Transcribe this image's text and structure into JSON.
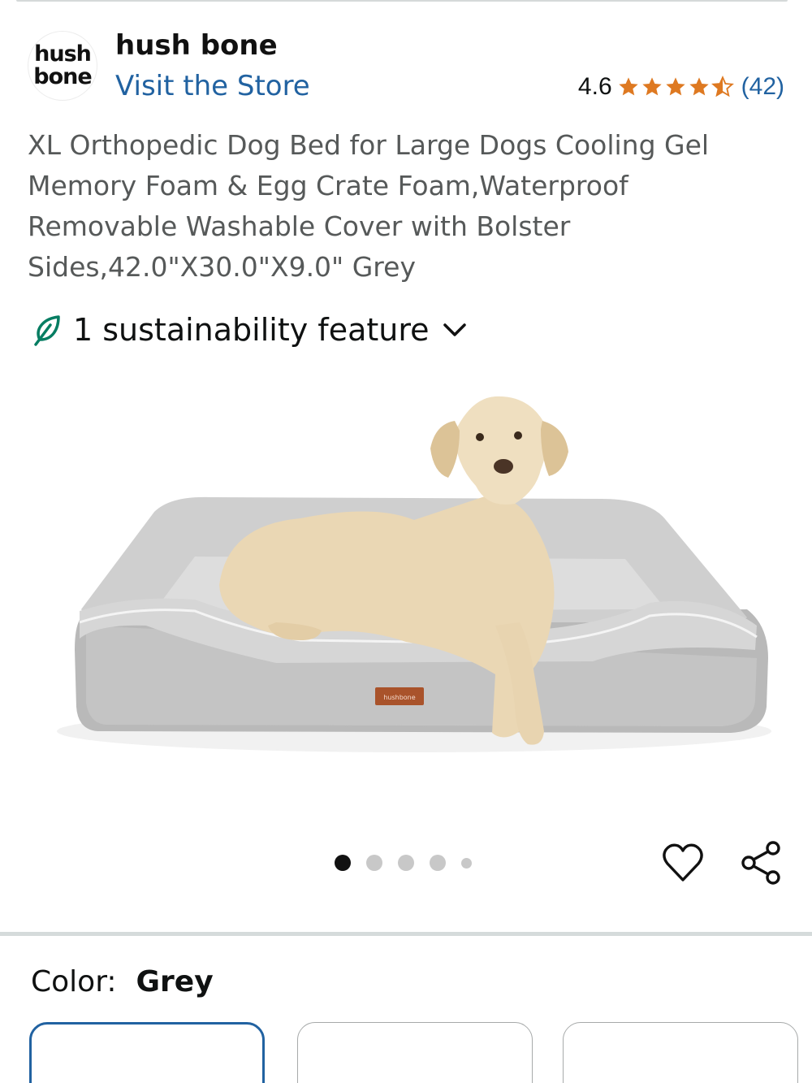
{
  "brand": {
    "logo_line1": "hush",
    "logo_line2": "bone",
    "name": "hush bone",
    "visit_store": "Visit the Store"
  },
  "rating": {
    "value": "4.6",
    "stars": 4.5,
    "count": "(42)",
    "star_color": "#de7921"
  },
  "product": {
    "title": "XL Orthopedic Dog Bed for Large Dogs Cooling Gel Memory Foam & Egg Crate Foam,Waterproof Removable Washable Cover with Bolster Sides,42.0\"X30.0\"X9.0\" Grey",
    "image_tag": "hushbone"
  },
  "sustainability": {
    "label": "1 sustainability feature",
    "icon": "leaf-icon",
    "icon_color": "#067d62"
  },
  "carousel": {
    "total_dots": 5,
    "active_index": 0
  },
  "actions": {
    "favorite_icon": "heart-icon",
    "share_icon": "share-icon"
  },
  "variation": {
    "label": "Color:",
    "selected_value": "Grey"
  },
  "colors": {
    "link": "#2162a1",
    "selected_border": "#2162a1"
  }
}
